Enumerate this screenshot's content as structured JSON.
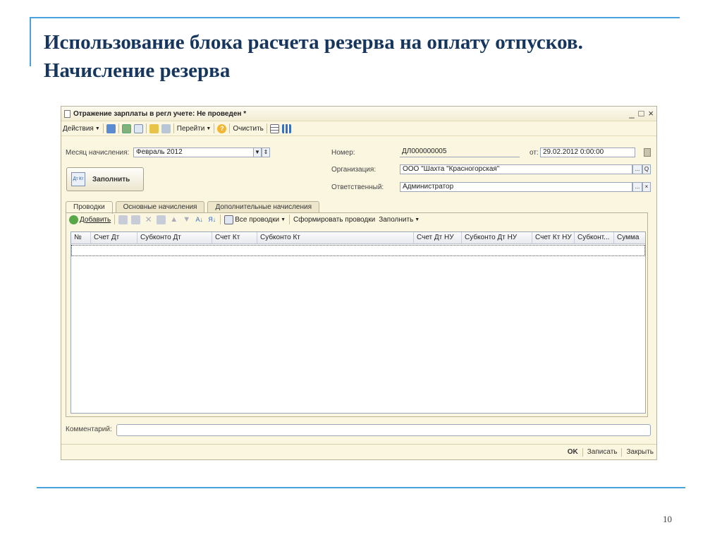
{
  "slide": {
    "title_line1": "Использование блока расчета резерва на оплату отпусков.",
    "title_line2": "Начисление резерва",
    "page_number": "10"
  },
  "window": {
    "title": "Отражение зарплаты в регл учете: Не проведен *",
    "controls": {
      "minimize": "_",
      "maximize": "□",
      "close": "×"
    }
  },
  "toolbar": {
    "actions_label": "Действия",
    "goto_label": "Перейти",
    "help_label": "?",
    "clear_label": "Очистить"
  },
  "form": {
    "month_label": "Месяц начисления:",
    "month_value": "Февраль 2012",
    "fill_button": "Заполнить",
    "fill_icon_text": "Дт Кт",
    "number_label": "Номер:",
    "number_value": "ДЛ000000005",
    "date_label": "от:",
    "date_value": "29.02.2012  0:00:00",
    "org_label": "Организация:",
    "org_value": "ООО \"Шахта \"Красногорская\"",
    "resp_label": "Ответственный:",
    "resp_value": "Администратор",
    "select_btn": "...",
    "search_btn": "Q",
    "clear_btn": "×"
  },
  "tabs": [
    "Проводки",
    "Основные начисления",
    "Дополнительные начисления"
  ],
  "panel_toolbar": {
    "add_label": "Добавить",
    "all_entries_label": "Все проводки",
    "generate_label": "Сформировать проводки",
    "fill_label": "Заполнить"
  },
  "table": {
    "columns": [
      "№",
      "Счет Дт",
      "Субконто Дт",
      "Счет Кт",
      "Субконто Кт",
      "Счет Дт НУ",
      "Субконто Дт НУ",
      "Счет Кт НУ",
      "Субконт...",
      "Сумма"
    ]
  },
  "comment_label": "Комментарий:",
  "status": {
    "ok": "OK",
    "save": "Записать",
    "close": "Закрыть"
  },
  "colors": {
    "title": "#17365d",
    "accent_line": "#4aa3df",
    "window_bg": "#fbf6df"
  }
}
